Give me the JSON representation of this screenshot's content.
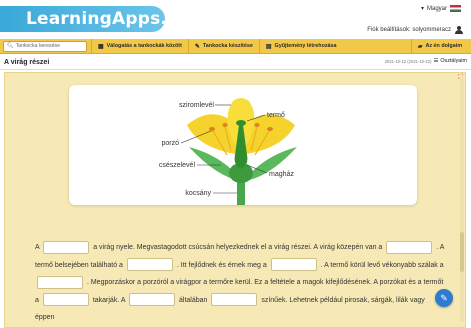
{
  "header": {
    "logo_text": "LearningApps.org",
    "language": "Magyar",
    "account_text": "Fiók beállítások: solyommeracz"
  },
  "nav": {
    "search_placeholder": "Tankocka keresése",
    "items": [
      {
        "label": "Válogatás a tankockák között",
        "icon": "grid-icon"
      },
      {
        "label": "Tankocka készítése",
        "icon": "pencil-icon"
      },
      {
        "label": "Gyűjtemény létrehozása",
        "icon": "collection-icon"
      },
      {
        "label": "Az én dolgaim",
        "icon": "folder-icon"
      }
    ]
  },
  "page": {
    "title": "A virág részei",
    "date": "2021-12-12 (2021-12-22)",
    "my_apps": "Osztályaim"
  },
  "diagram": {
    "labels": {
      "petal": "sziromlevél",
      "pistil": "termő",
      "stamen": "porzó",
      "sepal": "csészelevél",
      "ovary": "magház",
      "stem": "kocsány"
    }
  },
  "exercise": {
    "segments": [
      "A",
      "a virág nyele. Megvastagodott csúcsán helyezkednek el a virág részei. A virág közepén van a",
      ". A termő belsejében található a",
      ". Itt fejlődnek és érnek meg a",
      ". A termő körül levő vékonyabb szálak a",
      ". Megporzáskor a porzóról a virágpor a termőre kerül. Ez a feltétele a magok kifejlődésének. A porzókat és a termőt a",
      "takarják. A",
      "általában",
      "színűek. Lehetnek például pirosak, sárgák, lilák vagy éppen"
    ]
  },
  "colors": {
    "accent_nav": "#f2c849",
    "stage_bg": "#f6e9b6",
    "logo_blue": "#39a9d8",
    "edit_button": "#2f7bd1"
  }
}
